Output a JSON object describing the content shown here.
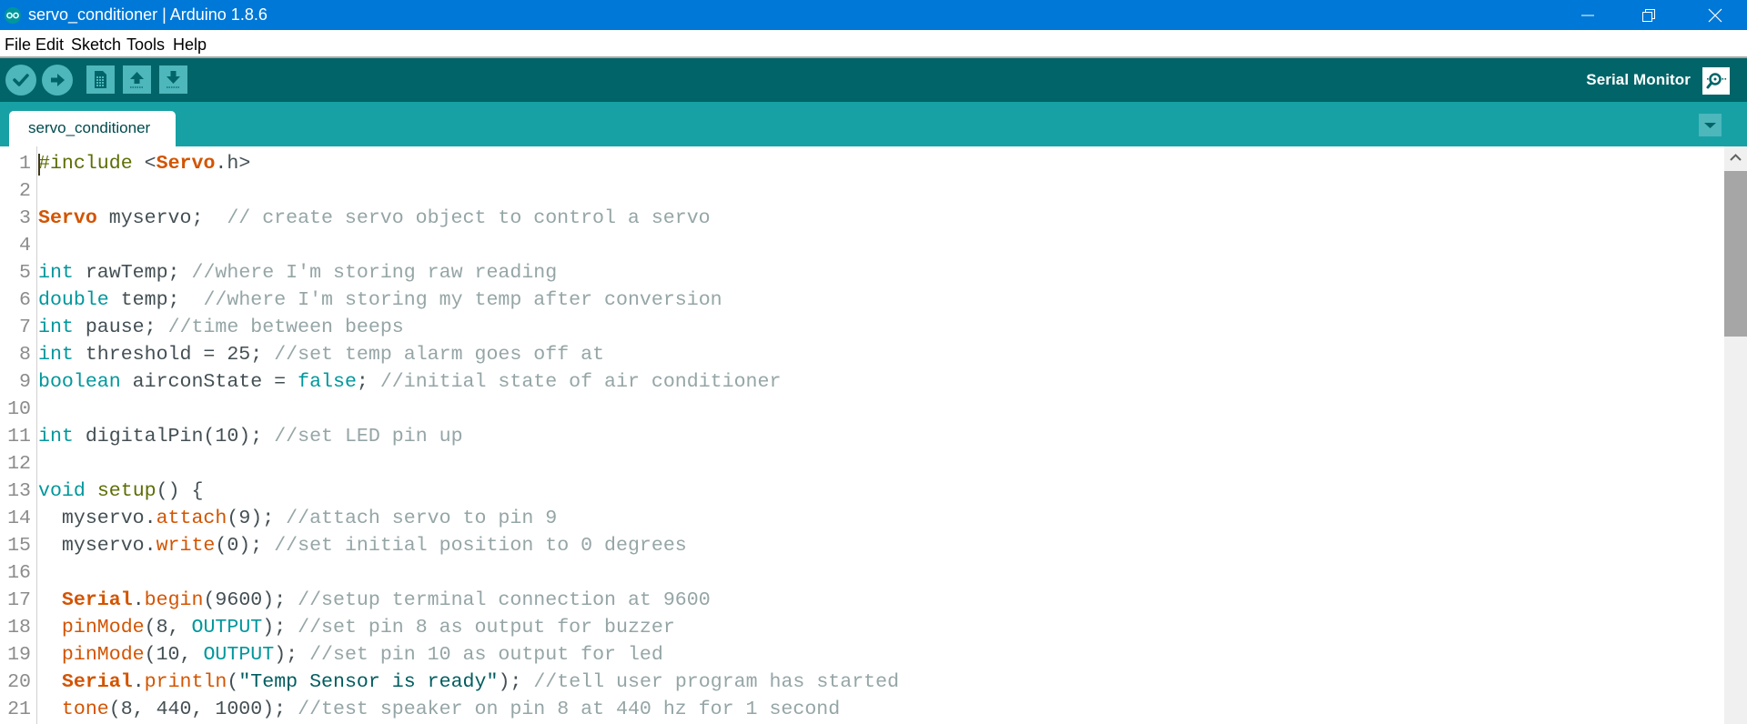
{
  "window": {
    "title": "servo_conditioner | Arduino 1.8.6",
    "controls": [
      "minimize",
      "restore",
      "close"
    ]
  },
  "menu": {
    "items": [
      "File",
      "Edit",
      "Sketch",
      "Tools",
      "Help"
    ]
  },
  "toolbar": {
    "buttons": [
      {
        "name": "verify",
        "icon": "checkmark-icon"
      },
      {
        "name": "upload",
        "icon": "arrow-right-icon"
      },
      {
        "name": "new",
        "icon": "document-icon"
      },
      {
        "name": "open",
        "icon": "arrow-up-icon"
      },
      {
        "name": "save",
        "icon": "arrow-down-icon"
      }
    ],
    "serial_monitor_label": "Serial Monitor"
  },
  "tabs": {
    "items": [
      {
        "label": "servo_conditioner",
        "active": true
      }
    ]
  },
  "editor": {
    "lines": [
      {
        "n": "1",
        "tokens": [
          {
            "t": "#include ",
            "c": "pp"
          },
          {
            "t": "<",
            "c": "tx"
          },
          {
            "t": "Servo",
            "c": "cls"
          },
          {
            "t": ".h>",
            "c": "tx"
          }
        ]
      },
      {
        "n": "2",
        "tokens": []
      },
      {
        "n": "3",
        "tokens": [
          {
            "t": "Servo",
            "c": "cls"
          },
          {
            "t": " myservo;  ",
            "c": "tx"
          },
          {
            "t": "// create servo object to control a servo",
            "c": "cm"
          }
        ]
      },
      {
        "n": "4",
        "tokens": []
      },
      {
        "n": "5",
        "tokens": [
          {
            "t": "int",
            "c": "kw"
          },
          {
            "t": " rawTemp; ",
            "c": "tx"
          },
          {
            "t": "//where I'm storing raw reading",
            "c": "cm"
          }
        ]
      },
      {
        "n": "6",
        "tokens": [
          {
            "t": "double",
            "c": "kw"
          },
          {
            "t": " temp;  ",
            "c": "tx"
          },
          {
            "t": "//where I'm storing my temp after conversion",
            "c": "cm"
          }
        ]
      },
      {
        "n": "7",
        "tokens": [
          {
            "t": "int",
            "c": "kw"
          },
          {
            "t": " pause; ",
            "c": "tx"
          },
          {
            "t": "//time between beeps",
            "c": "cm"
          }
        ]
      },
      {
        "n": "8",
        "tokens": [
          {
            "t": "int",
            "c": "kw"
          },
          {
            "t": " threshold = 25; ",
            "c": "tx"
          },
          {
            "t": "//set temp alarm goes off at",
            "c": "cm"
          }
        ]
      },
      {
        "n": "9",
        "tokens": [
          {
            "t": "boolean",
            "c": "kw"
          },
          {
            "t": " airconState = ",
            "c": "tx"
          },
          {
            "t": "false",
            "c": "const"
          },
          {
            "t": "; ",
            "c": "tx"
          },
          {
            "t": "//initial state of air conditioner",
            "c": "cm"
          }
        ]
      },
      {
        "n": "10",
        "tokens": []
      },
      {
        "n": "11",
        "tokens": [
          {
            "t": "int",
            "c": "kw"
          },
          {
            "t": " digitalPin(10); ",
            "c": "tx"
          },
          {
            "t": "//set LED pin up",
            "c": "cm"
          }
        ]
      },
      {
        "n": "12",
        "tokens": []
      },
      {
        "n": "13",
        "tokens": [
          {
            "t": "void",
            "c": "kw"
          },
          {
            "t": " ",
            "c": "tx"
          },
          {
            "t": "setup",
            "c": "pp"
          },
          {
            "t": "() {",
            "c": "tx"
          }
        ]
      },
      {
        "n": "14",
        "tokens": [
          {
            "t": "  myservo.",
            "c": "tx"
          },
          {
            "t": "attach",
            "c": "fn"
          },
          {
            "t": "(9); ",
            "c": "tx"
          },
          {
            "t": "//attach servo to pin 9",
            "c": "cm"
          }
        ]
      },
      {
        "n": "15",
        "tokens": [
          {
            "t": "  myservo.",
            "c": "tx"
          },
          {
            "t": "write",
            "c": "fn"
          },
          {
            "t": "(0); ",
            "c": "tx"
          },
          {
            "t": "//set initial position to 0 degrees",
            "c": "cm"
          }
        ]
      },
      {
        "n": "16",
        "tokens": []
      },
      {
        "n": "17",
        "tokens": [
          {
            "t": "  ",
            "c": "tx"
          },
          {
            "t": "Serial",
            "c": "cls"
          },
          {
            "t": ".",
            "c": "tx"
          },
          {
            "t": "begin",
            "c": "fn"
          },
          {
            "t": "(9600); ",
            "c": "tx"
          },
          {
            "t": "//setup terminal connection at 9600",
            "c": "cm"
          }
        ]
      },
      {
        "n": "18",
        "tokens": [
          {
            "t": "  ",
            "c": "tx"
          },
          {
            "t": "pinMode",
            "c": "fn"
          },
          {
            "t": "(8, ",
            "c": "tx"
          },
          {
            "t": "OUTPUT",
            "c": "const"
          },
          {
            "t": "); ",
            "c": "tx"
          },
          {
            "t": "//set pin 8 as output for buzzer",
            "c": "cm"
          }
        ]
      },
      {
        "n": "19",
        "tokens": [
          {
            "t": "  ",
            "c": "tx"
          },
          {
            "t": "pinMode",
            "c": "fn"
          },
          {
            "t": "(10, ",
            "c": "tx"
          },
          {
            "t": "OUTPUT",
            "c": "const"
          },
          {
            "t": "); ",
            "c": "tx"
          },
          {
            "t": "//set pin 10 as output for led",
            "c": "cm"
          }
        ]
      },
      {
        "n": "20",
        "tokens": [
          {
            "t": "  ",
            "c": "tx"
          },
          {
            "t": "Serial",
            "c": "cls"
          },
          {
            "t": ".",
            "c": "tx"
          },
          {
            "t": "println",
            "c": "fn"
          },
          {
            "t": "(",
            "c": "tx"
          },
          {
            "t": "\"Temp Sensor is ready\"",
            "c": "str"
          },
          {
            "t": "); ",
            "c": "tx"
          },
          {
            "t": "//tell user program has started",
            "c": "cm"
          }
        ]
      },
      {
        "n": "21",
        "tokens": [
          {
            "t": "  ",
            "c": "tx"
          },
          {
            "t": "tone",
            "c": "fn"
          },
          {
            "t": "(8, 440, 1000); ",
            "c": "tx"
          },
          {
            "t": "//test speaker on pin 8 at 440 hz for 1 second",
            "c": "cm"
          }
        ]
      }
    ]
  },
  "scrollbar": {
    "position_fraction": 0.0,
    "visible_fraction": 0.3
  },
  "colors": {
    "titlebar": "#0078d7",
    "toolbar": "#006468",
    "tabbar": "#17a1a5",
    "button": "#4db7bb",
    "keyword": "#00979c",
    "class": "#d35400",
    "comment": "#95a5a6",
    "preprocessor": "#5e6d03",
    "string": "#005c5f"
  }
}
